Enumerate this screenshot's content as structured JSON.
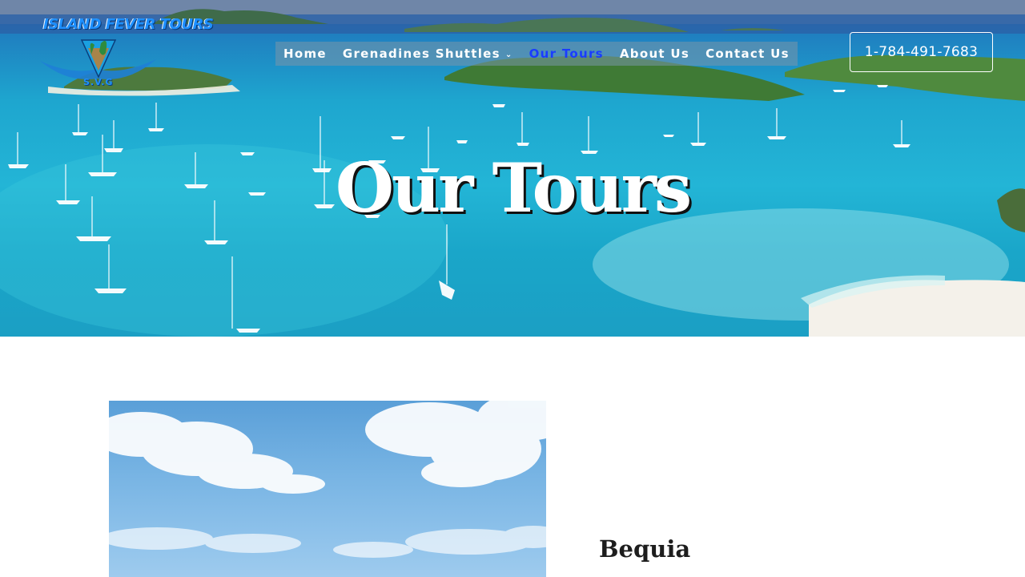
{
  "logo": {
    "text": "ISLAND FEVER TOURS",
    "sub": "S.V.G"
  },
  "nav": {
    "items": [
      {
        "label": "Home",
        "active": false
      },
      {
        "label": "Grenadines Shuttles",
        "active": false,
        "dropdown": true
      },
      {
        "label": "Our Tours",
        "active": true
      },
      {
        "label": "About Us",
        "active": false
      },
      {
        "label": "Contact Us",
        "active": false
      }
    ]
  },
  "phone": {
    "label": "1-784-491-7683"
  },
  "hero": {
    "title": "Our Tours"
  },
  "tours": [
    {
      "title": "Bequia"
    }
  ],
  "icons": {
    "dropdown": "chevron-down-icon"
  },
  "colors": {
    "active_nav": "#1a3cff",
    "text_dark": "#1d1d1d",
    "white": "#ffffff"
  }
}
